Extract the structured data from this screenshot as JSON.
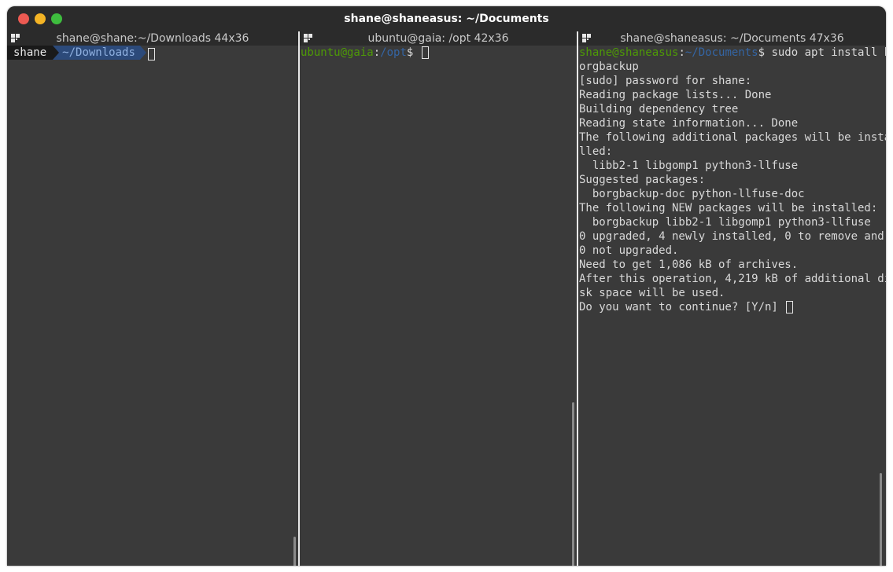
{
  "window": {
    "title": "shane@shaneasus: ~/Documents"
  },
  "panes": [
    {
      "title": "shane@shane:~/Downloads 44x36",
      "prompt_user": "shane",
      "prompt_dir": "~/Downloads"
    },
    {
      "title": "ubuntu@gaia: /opt 42x36",
      "prompt_userhost": "ubuntu@gaia",
      "prompt_sep": ":",
      "prompt_dir": "/opt",
      "prompt_symbol": "$ "
    },
    {
      "title": "shane@shaneasus: ~/Documents 47x36",
      "prompt_userhost": "shane@shaneasus",
      "prompt_sep": ":",
      "prompt_dir": "~/Documents",
      "command": "$ sudo apt install b",
      "lines": [
        "orgbackup",
        "[sudo] password for shane:",
        "Reading package lists... Done",
        "Building dependency tree",
        "Reading state information... Done",
        "The following additional packages will be insta",
        "lled:",
        "  libb2-1 libgomp1 python3-llfuse",
        "Suggested packages:",
        "  borgbackup-doc python-llfuse-doc",
        "The following NEW packages will be installed:",
        "  borgbackup libb2-1 libgomp1 python3-llfuse",
        "0 upgraded, 4 newly installed, 0 to remove and",
        "0 not upgraded.",
        "Need to get 1,086 kB of archives.",
        "After this operation, 4,219 kB of additional di",
        "sk space will be used.",
        "Do you want to continue? [Y/n] "
      ]
    }
  ],
  "icons": {
    "close": "close-icon",
    "minimize": "minimize-icon",
    "maximize": "maximize-icon",
    "pane_menu": "terminal-menu-icon",
    "cursor": "cursor-block"
  },
  "colors": {
    "close": "#ed5a52",
    "minimize": "#f4b425",
    "maximize": "#3ebd3e",
    "prompt_green": "#4e9a06",
    "prompt_blue": "#3465a4"
  }
}
